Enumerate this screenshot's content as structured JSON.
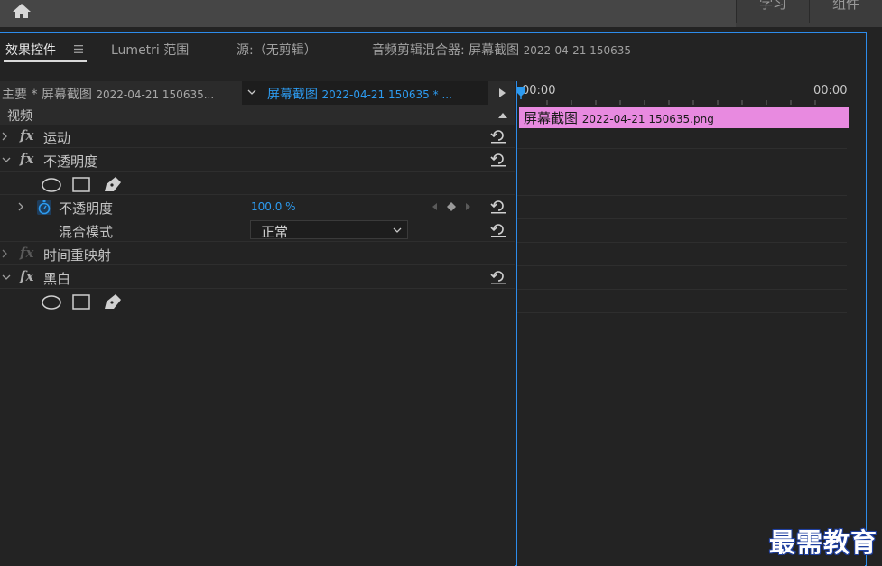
{
  "workspace_tabs": [
    "学习",
    "组件"
  ],
  "panel_tabs": {
    "effect_controls": "效果控件",
    "lumetri": "Lumetri 范围",
    "source": "源:（无剪辑）",
    "audio_mixer_prefix": "音频剪辑混合器: 屏幕截图",
    "audio_mixer_suffix": "2022-04-21 150635"
  },
  "clip_bar": {
    "master_prefix": "主要 * 屏幕截图",
    "master_suffix": "2022-04-21 150635...",
    "sequence_prefix": "屏幕截图",
    "sequence_suffix": "2022-04-21 150635 * ..."
  },
  "section_video": "视频",
  "effects": {
    "motion": "运动",
    "opacity": "不透明度",
    "opacity_param": "不透明度",
    "opacity_value": "100.0 %",
    "blend_mode_label": "混合模式",
    "blend_mode_value": "正常",
    "time_remap": "时间重映射",
    "black_white": "黑白"
  },
  "timeline": {
    "timecode_start": "00:00",
    "timecode_end": "00:00",
    "clip_prefix": "屏幕截图",
    "clip_suffix": "2022-04-21  150635.png"
  },
  "watermark": "最需教育",
  "colors": {
    "accent_blue": "#2d9bf0",
    "clip_pink": "#e88ae0",
    "panel_border": "#2d8ceb"
  }
}
